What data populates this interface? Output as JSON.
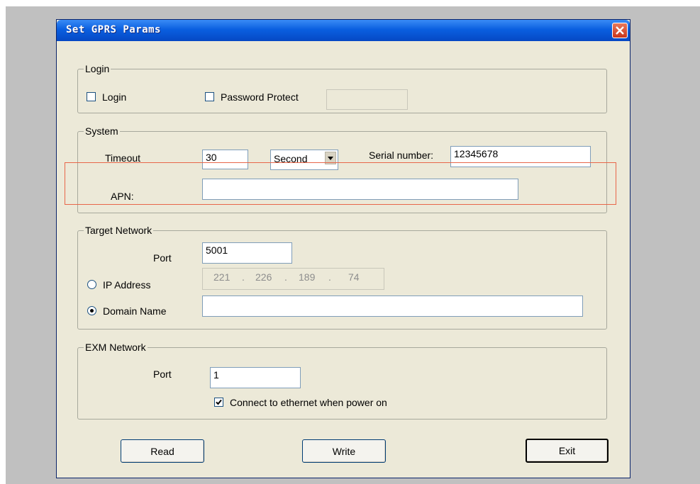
{
  "window": {
    "title": "Set GPRS Params"
  },
  "login": {
    "legend": "Login",
    "login_label": "Login",
    "login_checked": false,
    "password_label": "Password Protect",
    "password_checked": false,
    "password_value": ""
  },
  "system": {
    "legend": "System",
    "timeout_label": "Timeout",
    "timeout_value": "30",
    "unit_value": "Second",
    "serial_label": "Serial number:",
    "serial_value": "12345678",
    "apn_label": "APN:",
    "apn_value": ""
  },
  "target": {
    "legend": "Target Network",
    "port_label": "Port",
    "port_value": "5001",
    "ip_label": "IP Address",
    "ip_octets": [
      "221",
      "226",
      "189",
      "74"
    ],
    "domain_label": "Domain Name",
    "domain_value": "",
    "selected": "Domain Name"
  },
  "exm": {
    "legend": "EXM Network",
    "port_label": "Port",
    "port_value": "1",
    "connect_label": "Connect to ethernet when power on",
    "connect_checked": true
  },
  "buttons": {
    "read": "Read",
    "write": "Write",
    "exit": "Exit"
  },
  "colors": {
    "title_bar": "#0a5fe0",
    "highlight": "#e8664a",
    "dialog_bg": "#ece9d8"
  }
}
